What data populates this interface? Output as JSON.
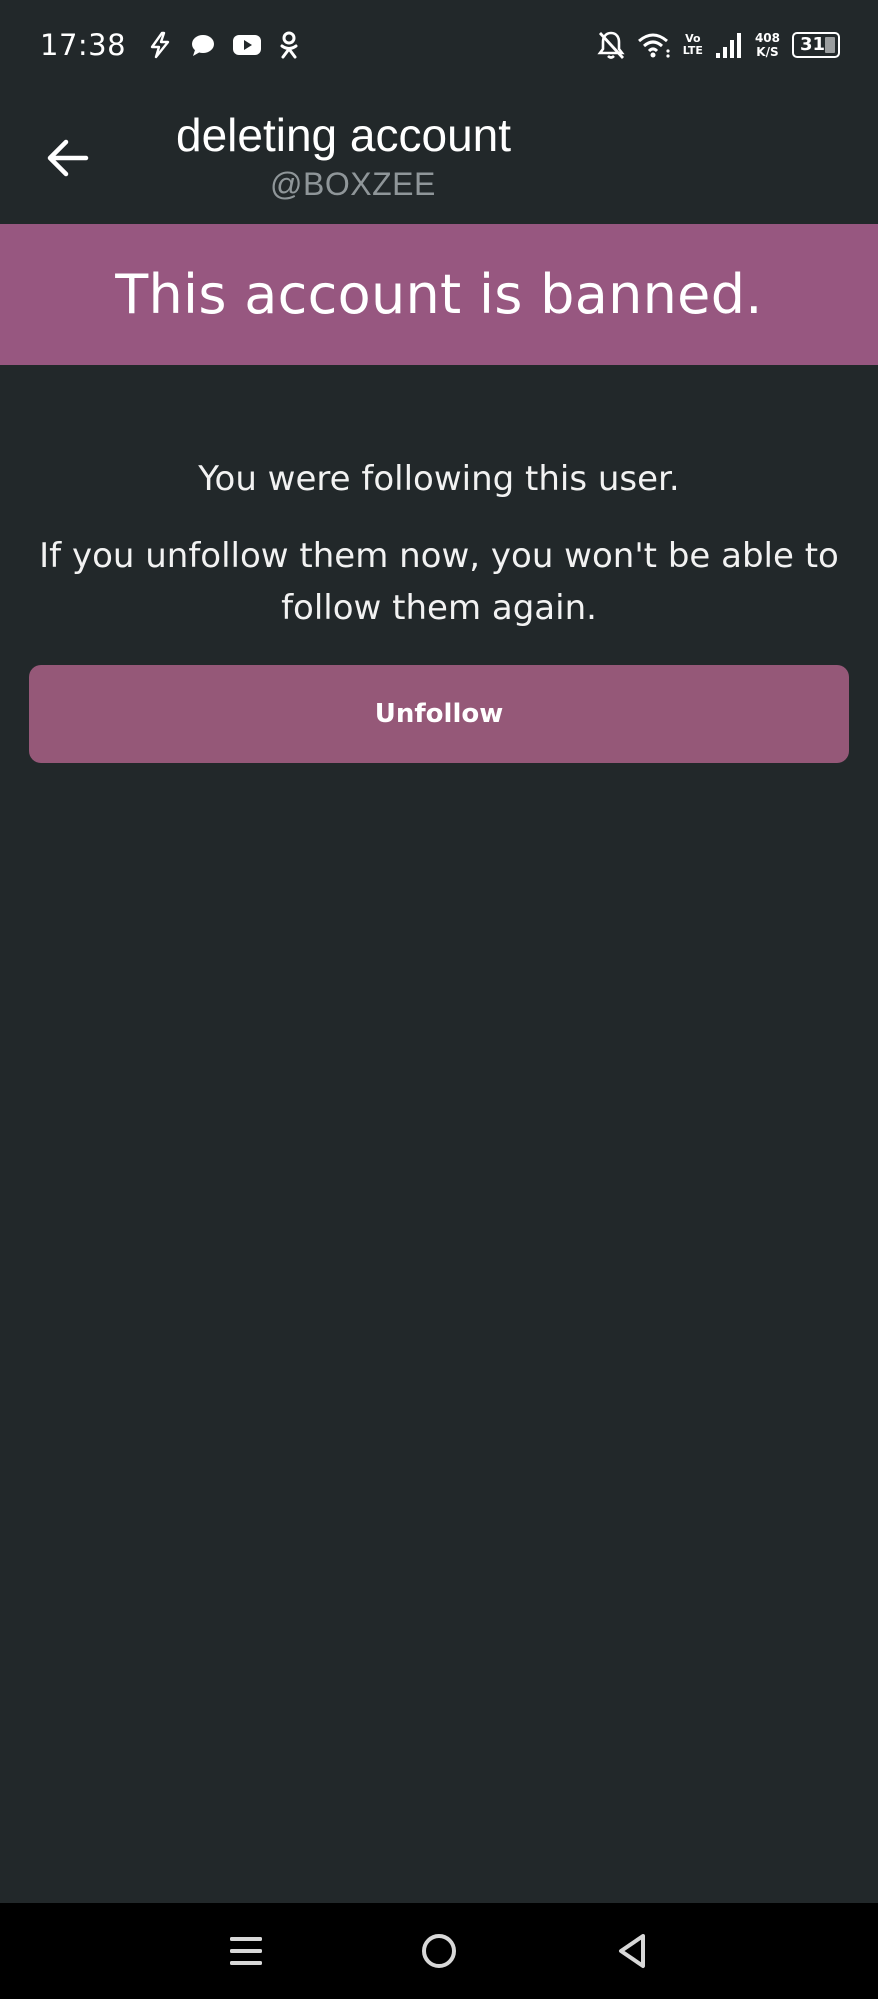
{
  "status_bar": {
    "time": "17:38",
    "left_icons": [
      "bolt-app-icon",
      "chat-bubble-icon",
      "youtube-icon",
      "odnoklassniki-icon"
    ],
    "lte_top": "Vo",
    "lte_bottom": "LTE",
    "speed_value": "408",
    "speed_unit": "K/S",
    "battery": "31"
  },
  "header": {
    "title": "deleting account",
    "handle": "@BOXZEE"
  },
  "banner": {
    "text": "This account is banned.",
    "color": "#975780"
  },
  "message": {
    "line1": "You were following this user.",
    "line2": "If you unfollow them now, you won't be able to follow them again."
  },
  "actions": {
    "unfollow_label": "Unfollow",
    "button_color": "#955878"
  },
  "nav_bar": {
    "buttons": [
      "menu-icon",
      "home-icon",
      "back-triangle-icon"
    ]
  },
  "colors": {
    "background": "#22282a",
    "handle_text": "#8f9699"
  }
}
